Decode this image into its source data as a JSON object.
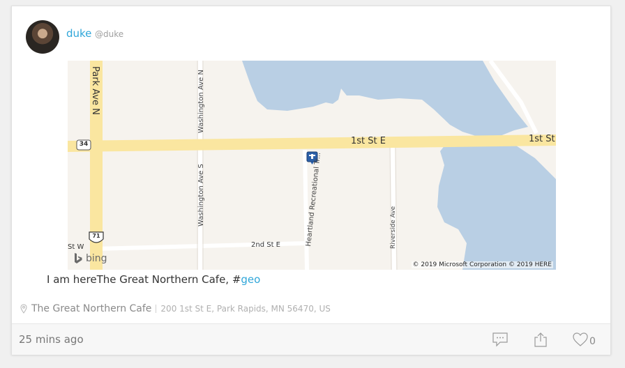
{
  "user": {
    "name": "duke",
    "handle": "@duke"
  },
  "map": {
    "labels": {
      "park_ave": "Park Ave N",
      "washington_n": "Washington Ave N",
      "washington_s": "Washington Ave S",
      "first_st_e": "1st St E",
      "first_st": "1st St",
      "highway_34": "34",
      "highway_71": "71",
      "heartland": "Heartland Recreational Tr...",
      "riverside": "Riverside Ave",
      "second_st_e": "2nd St E",
      "st_w": "St W"
    },
    "brand": "bing",
    "copyright": "© 2019 Microsoft Corporation © 2019 HERE",
    "colors": {
      "land": "#f6f3ee",
      "water": "#b9cfe4",
      "major_road": "#fae6a0",
      "minor_road": "#ffffff"
    }
  },
  "post": {
    "text": "I am hereThe Great Northern Cafe, #",
    "hashtag": "geo"
  },
  "location": {
    "name": "The Great Northern Cafe",
    "address": "200 1st St E, Park Rapids, MN 56470, US"
  },
  "footer": {
    "timestamp": "25 mins ago",
    "like_count": "0"
  },
  "accent_color": "#2fa6d9"
}
